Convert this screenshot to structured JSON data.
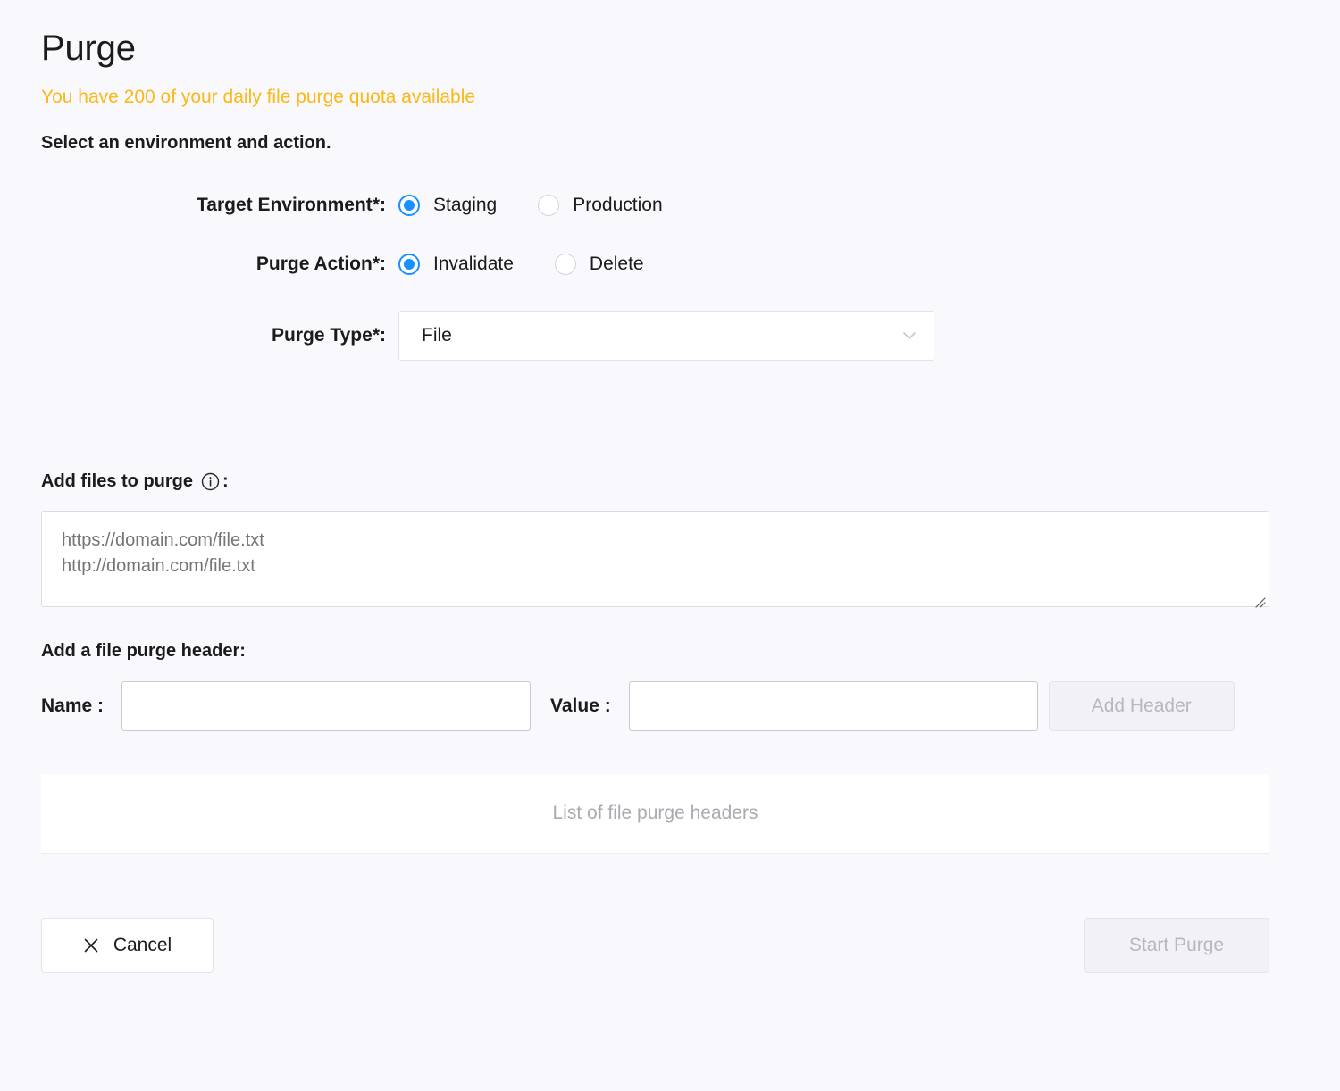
{
  "header": {
    "title": "Purge",
    "quota_message": "You have 200 of your daily file purge quota available",
    "instruction": "Select an environment and action."
  },
  "form": {
    "target_environment": {
      "label": "Target Environment",
      "required_mark": "*",
      "colon": ":",
      "options": [
        {
          "label": "Staging",
          "selected": true
        },
        {
          "label": "Production",
          "selected": false
        }
      ]
    },
    "purge_action": {
      "label": "Purge Action",
      "required_mark": "*",
      "colon": ":",
      "options": [
        {
          "label": "Invalidate",
          "selected": true
        },
        {
          "label": "Delete",
          "selected": false
        }
      ]
    },
    "purge_type": {
      "label": "Purge Type",
      "required_mark": "*",
      "colon": ":",
      "selected_value": "File",
      "chevron_icon": "chevron-down-icon"
    }
  },
  "files_section": {
    "heading": "Add files to purge",
    "info_icon": "info-icon",
    "colon": ":",
    "textarea_placeholder": "https://domain.com/file.txt\nhttp://domain.com/file.txt",
    "textarea_value": "",
    "resize_handle_icon": "resize-grip-icon"
  },
  "headers_section": {
    "heading": "Add a file purge header:",
    "name_label": "Name :",
    "name_value": "",
    "value_label": "Value :",
    "value_value": "",
    "add_header_button": "Add Header",
    "list_empty_text": "List of file purge headers"
  },
  "footer": {
    "cancel_label": "Cancel",
    "cancel_icon": "close-x-icon",
    "start_purge_label": "Start Purge"
  },
  "colors": {
    "page_background": "#f8f8fd",
    "accent_blue": "#1890ff",
    "quota_amber": "#fcb813",
    "disabled_text": "#b7b7bf",
    "disabled_bg": "#f2f2f6",
    "placeholder": "#b6b6be"
  }
}
